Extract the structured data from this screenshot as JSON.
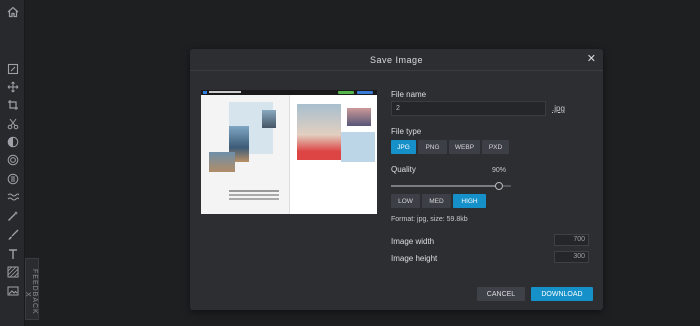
{
  "feedback_label": "FEEDBACK",
  "feedback_close": "X",
  "toolbar": {
    "home_icon": "home-icon",
    "tools": [
      "edit-icon",
      "move-icon",
      "crop-icon",
      "cut-icon",
      "adjust-icon",
      "filter-icon",
      "effect-icon",
      "wave-icon",
      "wand-icon",
      "brush-icon",
      "text-icon",
      "pattern-icon",
      "image-icon"
    ]
  },
  "dialog": {
    "title": "Save Image",
    "close_glyph": "✕",
    "file_name_label": "File name",
    "file_name_value": "2",
    "file_extension": ".jpg",
    "file_type_label": "File type",
    "file_types": [
      "JPG",
      "PNG",
      "WEBP",
      "PXD"
    ],
    "file_type_selected": "JPG",
    "quality_label": "Quality",
    "quality_value": "90%",
    "quality_level": 0.9,
    "quality_presets": [
      "LOW",
      "MED",
      "HIGH"
    ],
    "quality_preset_selected": "HIGH",
    "format_info": "Format: jpg, size: 59.8kb",
    "image_width_label": "Image width",
    "image_width_value": "700",
    "image_height_label": "Image height",
    "image_height_value": "300",
    "cancel_label": "CANCEL",
    "download_label": "DOWNLOAD",
    "accent_color": "#1590c9"
  }
}
